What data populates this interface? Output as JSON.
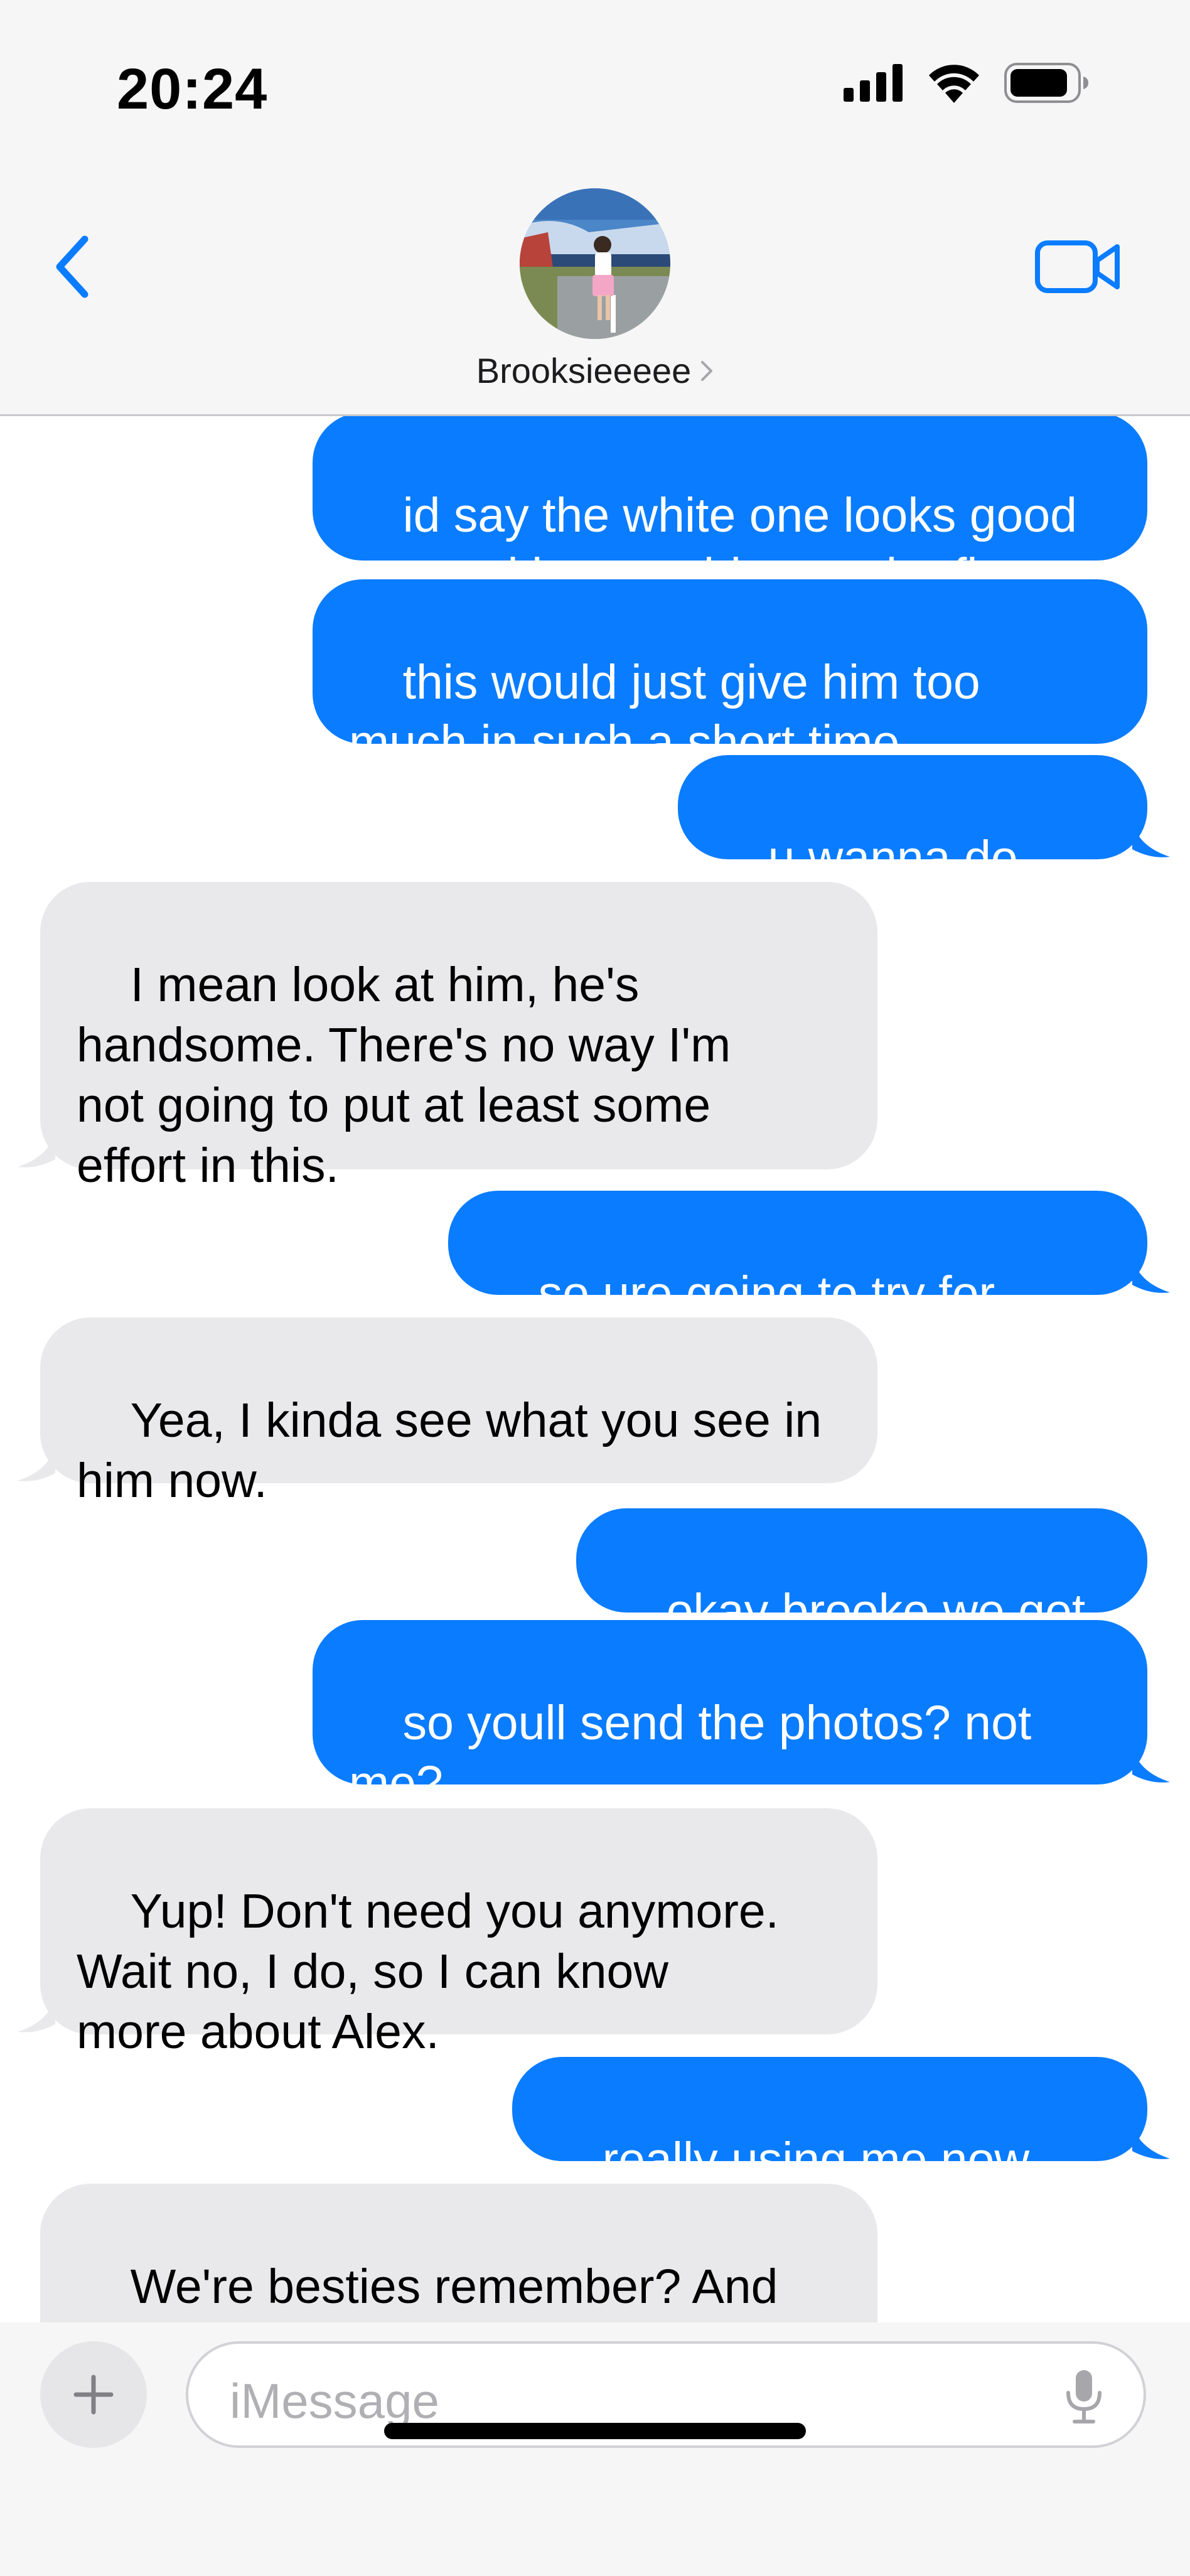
{
  "status_bar": {
    "time": "20:24"
  },
  "header": {
    "contact_name": "Brooksieeeee"
  },
  "messages": [
    {
      "direction": "out",
      "text": "id say the white one looks good\nor go with something easier first"
    },
    {
      "direction": "out",
      "text": "this would just give him too\nmuch in such a short time"
    },
    {
      "direction": "out",
      "text": "u wanna do that?"
    },
    {
      "direction": "in",
      "text": "I mean look at him, he's\nhandsome. There's no way I'm\nnot going to put at least some\neffort in this."
    },
    {
      "direction": "out",
      "text": "so ure going to try for him?"
    },
    {
      "direction": "in",
      "text": "Yea, I kinda see what you see in\nhim now."
    },
    {
      "direction": "out",
      "text": "okay brooke we get it"
    },
    {
      "direction": "out",
      "text": "so youll send the photos? not\nme?"
    },
    {
      "direction": "in",
      "text": "Yup! Don't need you anymore.\nWait no, I do, so I can know\nmore about Alex."
    },
    {
      "direction": "out",
      "text": "really using me now huh"
    },
    {
      "direction": "in",
      "text": "We're besties remember? And\nAlex sure is having fun being"
    }
  ],
  "composer": {
    "placeholder": "iMessage"
  },
  "colors": {
    "outgoing_bubble": "#0a7cff",
    "incoming_bubble": "#e9e9eb",
    "accent": "#0a7cff"
  },
  "icons": {
    "back": "chevron-left-icon",
    "video": "video-camera-icon",
    "plus": "plus-icon",
    "mic": "microphone-icon",
    "signal": "cellular-signal-icon",
    "wifi": "wifi-icon",
    "battery": "battery-icon"
  }
}
